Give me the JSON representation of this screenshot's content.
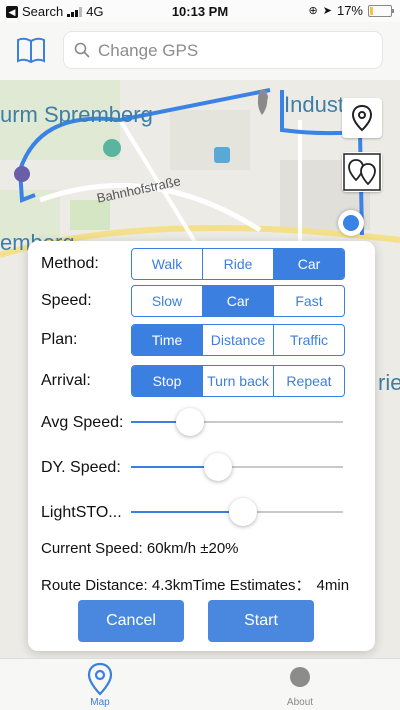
{
  "status_bar": {
    "carrier": "Search",
    "network": "4G",
    "time": "10:13 PM",
    "battery": "17%",
    "battery_level": 0.17
  },
  "top_bar": {
    "menu_icon": "book-icon",
    "search_placeholder": "Change GPS",
    "search_icon": "search-icon"
  },
  "map": {
    "labels": {
      "place_left": "urm Spremberg",
      "place_right": "Industr",
      "street": "Bahnhofstraße",
      "place_cut_left": "emberg",
      "place_cut_right": "rie"
    },
    "buttons": [
      {
        "icon": "map-pin-icon"
      },
      {
        "icon": "multi-pin-icon"
      }
    ],
    "location_marker": "gps-location-icon"
  },
  "dialog": {
    "method": {
      "label": "Method:",
      "options": [
        "Walk",
        "Ride",
        "Car"
      ],
      "selected": 2
    },
    "speed": {
      "label": "Speed:",
      "options": [
        "Slow",
        "Car",
        "Fast"
      ],
      "selected": 1
    },
    "plan": {
      "label": "Plan:",
      "options": [
        "Time",
        "Distance",
        "Traffic"
      ],
      "selected": 0
    },
    "arrival": {
      "label": "Arrival:",
      "options": [
        "Stop",
        "Turn back",
        "Repeat"
      ],
      "selected": 0
    },
    "sliders": [
      {
        "label": "Avg Speed:",
        "value": 0.28
      },
      {
        "label": "DY. Speed:",
        "value": 0.41
      },
      {
        "label": "LightSTO...",
        "value": 0.53
      }
    ],
    "current_speed": "Current Speed: 60km/h ±20%",
    "route_distance": "Route Distance: 4.3km",
    "time_estimates": "Time Estimates：",
    "time_value": "4min",
    "cancel_label": "Cancel",
    "start_label": "Start"
  },
  "tab_bar": {
    "tabs": [
      {
        "label": "Map",
        "icon": "map-pin-icon",
        "active": true
      },
      {
        "label": "About",
        "icon": "about-icon",
        "active": false
      }
    ],
    "accent_color": "#3b7fe0"
  }
}
